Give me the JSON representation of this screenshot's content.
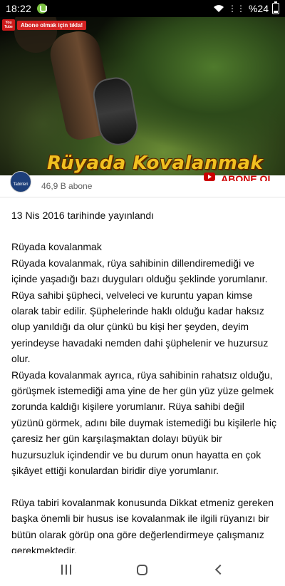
{
  "status_bar": {
    "time": "18:22",
    "battery": "%24",
    "icons": [
      "notification-icon",
      "wifi-icon",
      "mute-icon",
      "battery-icon"
    ]
  },
  "video": {
    "title_overlay": "Rüyada Kovalanmak",
    "badge_logo": "You Tube",
    "subscribe_banner": "Abone olmak için tıkla!"
  },
  "channel": {
    "avatar_text": "Tabirleri",
    "subscribers": "46,9 B abone",
    "subscribe_label": "ABONE OL"
  },
  "description": {
    "published": "13 Nis 2016 tarihinde yayınlandı",
    "body": "Rüyada kovalanmak\nRüyada kovalanmak, rüya sahibinin dillendiremediği ve içinde yaşadığı bazı duyguları olduğu şeklinde yorumlanır. Rüya sahibi şüpheci, velveleci ve kuruntu yapan kimse olarak tabir edilir. Şüphelerinde haklı olduğu kadar haksız olup yanıldığı da olur çünkü bu kişi her şeyden, deyim yerindeyse havadaki nemden dahi şüphelenir ve huzursuz olur.\nRüyada kovalanmak ayrıca, rüya sahibinin rahatsız olduğu, görüşmek istemediği ama yine de her gün yüz yüze gelmek zorunda kaldığı kişilere yorumlanır. Rüya sahibi değil yüzünü görmek, adını bile duymak istemediği bu kişilerle hiç çaresiz her gün karşılaşmaktan dolayı büyük bir huzursuzluk içindendir ve bu durum onun hayatta en çok şikâyet ettiği konulardan biridir diye yorumlanır.\n\nRüya tabiri kovalanmak konusunda Dikkat etmeniz gereken başka önemli bir husus ise kovalanmak ile ilgili rüyanızı bir bütün olarak görüp ona göre değerlendirmeye çalışmanız gerekmektedir."
  },
  "nav": {
    "icons": [
      "recents-icon",
      "home-icon",
      "back-icon"
    ]
  }
}
